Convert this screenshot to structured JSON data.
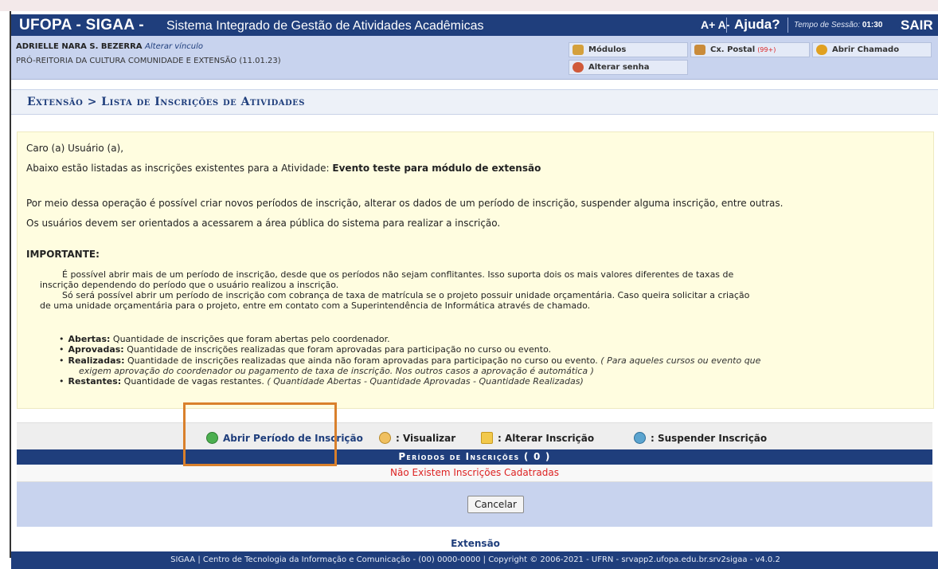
{
  "header": {
    "brand": "UFOPA - SIGAA -",
    "subtitle": "Sistema Integrado de Gestão de Atividades Acadêmicas",
    "font_controls": "A+ A-",
    "help": "Ajuda?",
    "session_label": "Tempo de Sessão:",
    "session_time": "01:30",
    "logout": "SAIR"
  },
  "user": {
    "name": "ADRIELLE NARA S. BEZERRA",
    "change_link": "Alterar vínculo",
    "department": "PRÓ-REITORIA DA CULTURA COMUNIDADE E EXTENSÃO (11.01.23)"
  },
  "menu": {
    "modules": "Módulos",
    "mailbox": "Cx. Postal",
    "mailbox_count": "(99+)",
    "open_ticket": "Abrir Chamado",
    "change_password": "Alterar senha"
  },
  "breadcrumb": "Extensão > Lista de Inscrições de Atividades",
  "info": {
    "greeting": "Caro (a) Usuário (a),",
    "activity_intro": "Abaixo estão listadas as inscrições existentes para a Atividade:",
    "activity_name": "Evento teste para módulo de extensão",
    "paragraph1": "Por meio dessa operação é possível criar novos períodos de inscrição, alterar os dados de um período de inscrição, suspender alguma inscrição, entre outras.",
    "paragraph2": "Os usuários devem ser orientados a acessarem a área pública do sistema para realizar a inscrição.",
    "important_title": "IMPORTANTE:",
    "important1_line1": "É possível abrir mais de um período de inscrição, desde que os períodos não sejam conflitantes. Isso suporta dois os mais valores diferentes de taxas de",
    "important1_line2": "inscrição dependendo do período que o usuário realizou a inscrição.",
    "important2_line1": "Só será possível abrir um período de inscrição com cobrança de taxa de matrícula se o projeto possuir unidade orçamentária. Caso queira solicitar a criação",
    "important2_line2": "de uma unidade orçamentária para o projeto, entre em contato com a Superintendência de Informática através de chamado.",
    "bullets": {
      "open_label": "Abertas:",
      "open_text": "Quantidade de inscrições que foram abertas pelo coordenador.",
      "approved_label": "Aprovadas:",
      "approved_text": "Quantidade de inscrições realizadas que foram aprovadas para participação no curso ou evento.",
      "done_label": "Realizadas:",
      "done_text": "Quantidade de inscrições realizadas que ainda não foram aprovadas para participação no curso ou evento.",
      "done_note_line1": "( Para aqueles cursos ou evento que",
      "done_note_line2": "exigem aprovação do coordenador ou pagamento de taxa de inscrição. Nos outros casos a aprovação é automática )",
      "remaining_label": "Restantes:",
      "remaining_text": "Quantidade de vagas restantes.",
      "remaining_note": "( Quantidade Abertas - Quantidade Aprovadas - Quantidade Realizadas)"
    }
  },
  "actions": {
    "open_period": "Abrir Período de Inscrição",
    "view": ": Visualizar",
    "edit": ": Alterar Inscrição",
    "suspend": ": Suspender Inscrição"
  },
  "table": {
    "title": "Períodos de Inscrições ( 0 )",
    "empty_message": "Não Existem Inscrições Cadatradas"
  },
  "buttons": {
    "cancel": "Cancelar"
  },
  "footer": {
    "module_name": "Extensão",
    "text": "SIGAA | Centro de Tecnologia da Informação e Comunicação - (00) 0000-0000 | Copyright © 2006-2021 - UFRN - srvapp2.ufopa.edu.br.srv2sigaa - v4.0.2"
  },
  "colors": {
    "header_bg": "#1f3e7c",
    "userbar_bg": "#c8d3ee",
    "info_bg": "#fffde0",
    "highlight": "#d9802c",
    "error_text": "#dd2222"
  }
}
